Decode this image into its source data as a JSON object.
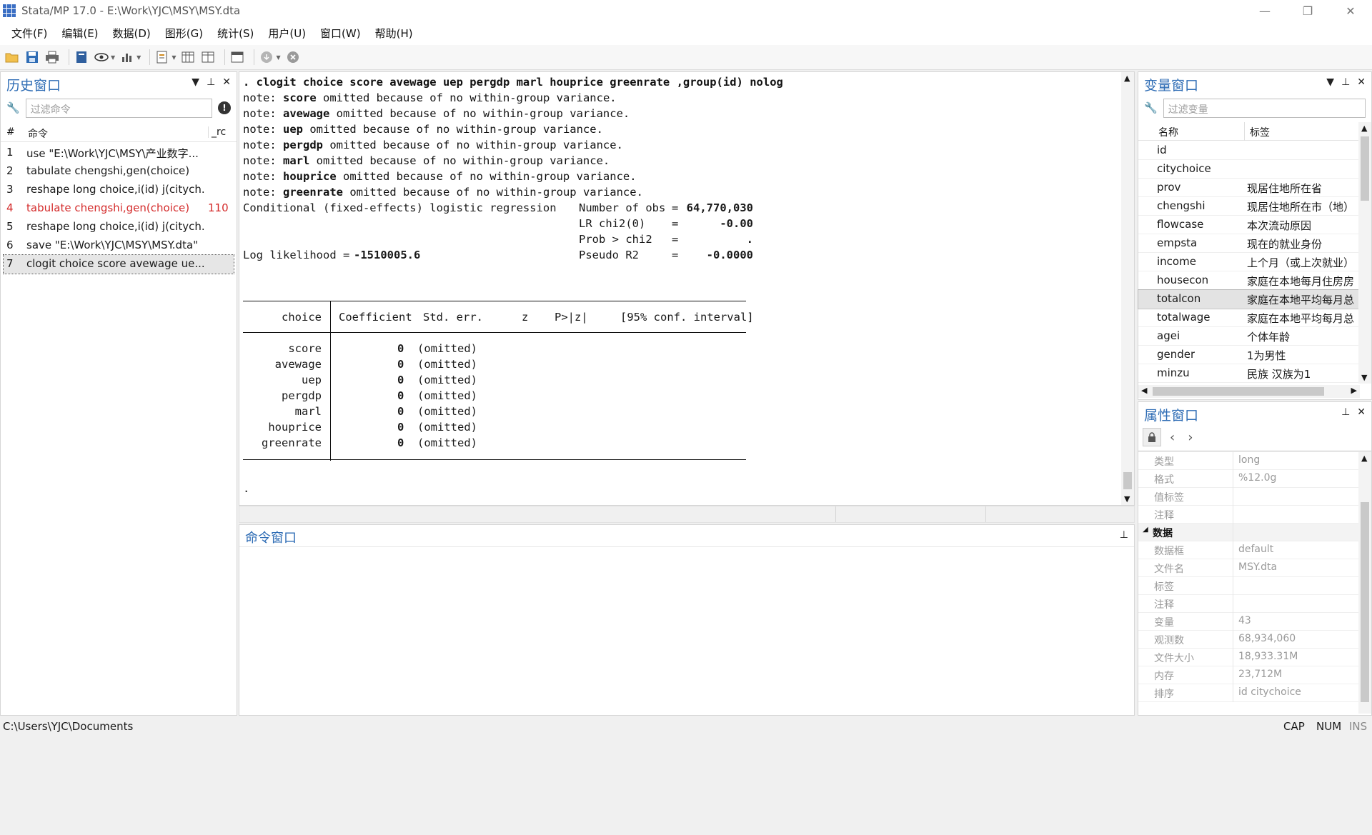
{
  "window": {
    "title": "Stata/MP 17.0 - E:\\Work\\YJC\\MSY\\MSY.dta",
    "controls": [
      "minimize-icon",
      "restore-icon",
      "close-icon"
    ]
  },
  "menu": [
    "文件(F)",
    "编辑(E)",
    "数据(D)",
    "图形(G)",
    "统计(S)",
    "用户(U)",
    "窗口(W)",
    "帮助(H)"
  ],
  "toolbar": {
    "icons": [
      "open-icon",
      "save-icon",
      "print-icon",
      "log-icon",
      "viewer-icon",
      "graph-icon",
      "do-file-editor-icon",
      "data-editor-icon",
      "data-browser-icon",
      "variables-manager-icon",
      "more-icon",
      "break-icon"
    ]
  },
  "history": {
    "title": "历史窗口",
    "filter_placeholder": "过滤命令",
    "col_num": "#",
    "col_cmd": "命令",
    "col_rc": "_rc",
    "rows": [
      {
        "n": "1",
        "cmd": "use \"E:\\Work\\YJC\\MSY\\产业数字...",
        "rc": ""
      },
      {
        "n": "2",
        "cmd": "tabulate chengshi,gen(choice)",
        "rc": ""
      },
      {
        "n": "3",
        "cmd": "reshape long choice,i(id) j(citych...",
        "rc": ""
      },
      {
        "n": "4",
        "cmd": "tabulate chengshi,gen(choice)",
        "rc": "110"
      },
      {
        "n": "5",
        "cmd": "reshape long choice,i(id) j(citych...",
        "rc": ""
      },
      {
        "n": "6",
        "cmd": "save \"E:\\Work\\YJC\\MSY\\MSY.dta\"",
        "rc": ""
      },
      {
        "n": "7",
        "cmd": "clogit choice score avewage ue...",
        "rc": ""
      }
    ]
  },
  "results": {
    "command": ". clogit choice score avewage uep pergdp marl houprice greenrate ,group(id) nolog",
    "notes": [
      {
        "prefix": "note: ",
        "var": "score",
        "text": " omitted because of no within-group variance."
      },
      {
        "prefix": "note: ",
        "var": "avewage",
        "text": " omitted because of no within-group variance."
      },
      {
        "prefix": "note: ",
        "var": "uep",
        "text": " omitted because of no within-group variance."
      },
      {
        "prefix": "note: ",
        "var": "pergdp",
        "text": " omitted because of no within-group variance."
      },
      {
        "prefix": "note: ",
        "var": "marl",
        "text": " omitted because of no within-group variance."
      },
      {
        "prefix": "note: ",
        "var": "houprice",
        "text": " omitted because of no within-group variance."
      },
      {
        "prefix": "note: ",
        "var": "greenrate",
        "text": " omitted because of no within-group variance."
      }
    ],
    "model_title": "Conditional (fixed-effects) logistic regression",
    "stats": [
      {
        "label": "Number of obs",
        "value": "64,770,030"
      },
      {
        "label": "LR chi2(0)",
        "value": "-0.00"
      },
      {
        "label": "Prob > chi2",
        "value": "."
      },
      {
        "label": "Pseudo R2",
        "value": "-0.0000"
      }
    ],
    "loglik_label": "Log likelihood = ",
    "loglik_value": "-1510005.6",
    "table_headers": {
      "depvar": "choice",
      "coef": "Coefficient",
      "se": "Std. err.",
      "z": "z",
      "p": "P>|z|",
      "ci": "[95% conf. interval]"
    },
    "coef_rows": [
      {
        "var": "score",
        "coef": "0",
        "note": "(omitted)"
      },
      {
        "var": "avewage",
        "coef": "0",
        "note": "(omitted)"
      },
      {
        "var": "uep",
        "coef": "0",
        "note": "(omitted)"
      },
      {
        "var": "pergdp",
        "coef": "0",
        "note": "(omitted)"
      },
      {
        "var": "marl",
        "coef": "0",
        "note": "(omitted)"
      },
      {
        "var": "houprice",
        "coef": "0",
        "note": "(omitted)"
      },
      {
        "var": "greenrate",
        "coef": "0",
        "note": "(omitted)"
      }
    ],
    "prompt": "."
  },
  "command_window": {
    "title": "命令窗口",
    "value": ""
  },
  "variables": {
    "title": "变量窗口",
    "filter_placeholder": "过滤变量",
    "col_name": "名称",
    "col_label": "标签",
    "rows": [
      {
        "name": "id",
        "label": ""
      },
      {
        "name": "citychoice",
        "label": ""
      },
      {
        "name": "prov",
        "label": "现居住地所在省"
      },
      {
        "name": "chengshi",
        "label": "现居住地所在市（地）"
      },
      {
        "name": "flowcase",
        "label": "本次流动原因"
      },
      {
        "name": "empsta",
        "label": "现在的就业身份"
      },
      {
        "name": "income",
        "label": "上个月（或上次就业）"
      },
      {
        "name": "housecon",
        "label": "家庭在本地每月住房房"
      },
      {
        "name": "totalcon",
        "label": "家庭在本地平均每月总"
      },
      {
        "name": "totalwage",
        "label": "家庭在本地平均每月总"
      },
      {
        "name": "agei",
        "label": "个体年龄"
      },
      {
        "name": "gender",
        "label": "1为男性"
      },
      {
        "name": "minzu",
        "label": "民族 汉族为1"
      }
    ]
  },
  "properties": {
    "title": "属性窗口",
    "rows": [
      {
        "key": "类型",
        "value": "long",
        "section": false
      },
      {
        "key": "格式",
        "value": "%12.0g",
        "section": false
      },
      {
        "key": "值标签",
        "value": "",
        "section": false
      },
      {
        "key": "注释",
        "value": "",
        "section": false
      },
      {
        "key": "数据",
        "value": "",
        "section": true
      },
      {
        "key": "数据框",
        "value": "default",
        "section": false
      },
      {
        "key": "文件名",
        "value": "MSY.dta",
        "section": false
      },
      {
        "key": "标签",
        "value": "",
        "section": false
      },
      {
        "key": "注释",
        "value": "",
        "section": false
      },
      {
        "key": "变量",
        "value": "43",
        "section": false
      },
      {
        "key": "观测数",
        "value": "68,934,060",
        "section": false
      },
      {
        "key": "文件大小",
        "value": "18,933.31M",
        "section": false
      },
      {
        "key": "内存",
        "value": "23,712M",
        "section": false
      },
      {
        "key": "排序",
        "value": "id citychoice",
        "section": false
      }
    ]
  },
  "status": {
    "path": "C:\\Users\\YJC\\Documents",
    "indicators": [
      "CAP",
      "NUM",
      "INS"
    ]
  }
}
